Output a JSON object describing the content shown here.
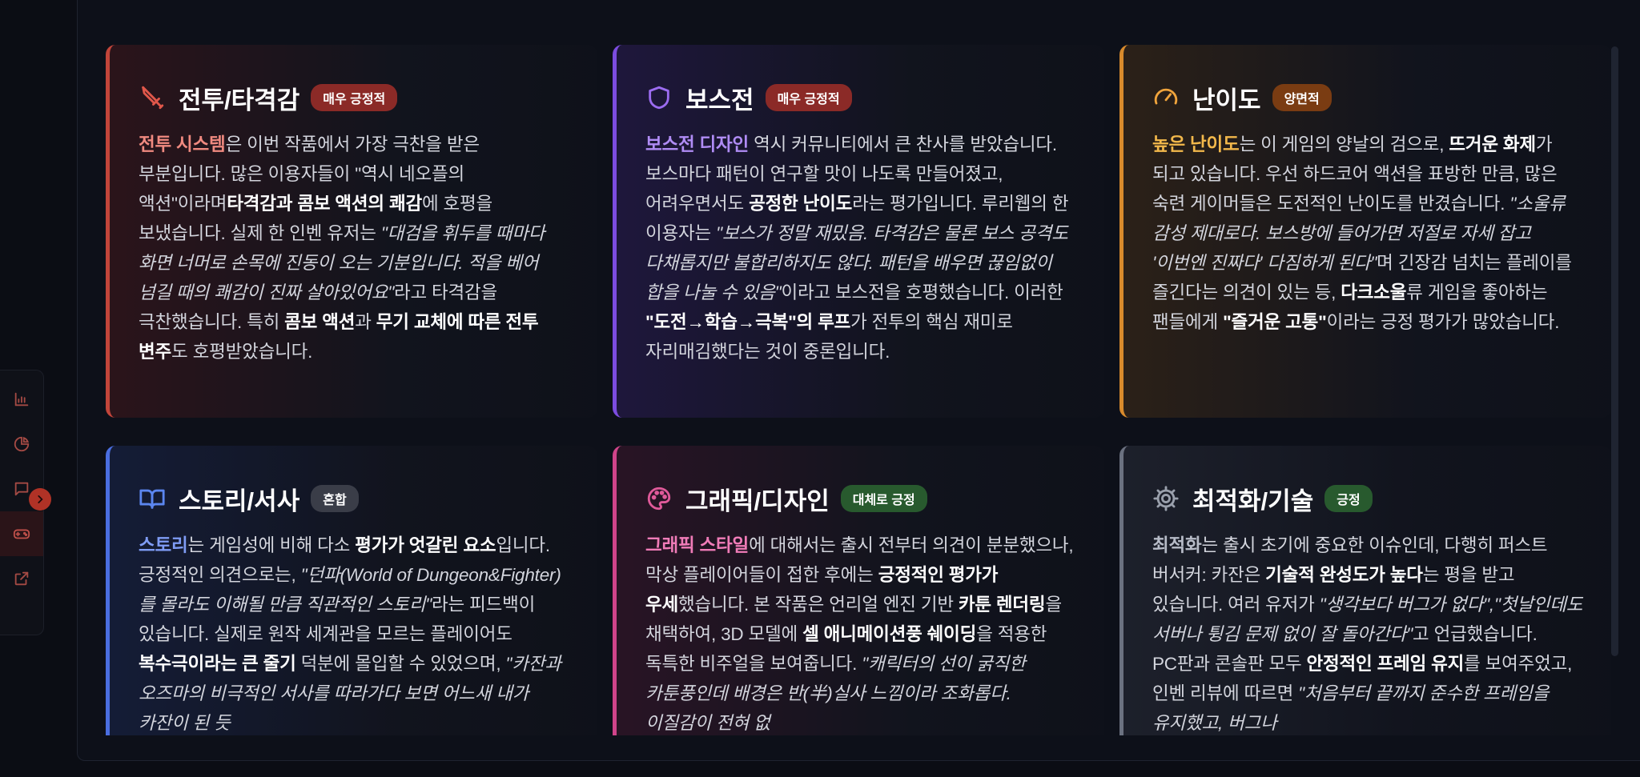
{
  "colors": {
    "battle": "#c2453a",
    "boss": "#7c4ce0",
    "difficulty": "#d88a2c",
    "story": "#4a6ee0",
    "graphics": "#d0448a",
    "tech": "#7d8494",
    "badge_very_positive": "#8b2a27",
    "badge_mixed_side": "#7a3c12",
    "badge_mixed": "#3a3d48",
    "badge_positive": "#285a2e"
  },
  "sidebar": {
    "items": [
      {
        "icon": "bar-chart-icon"
      },
      {
        "icon": "pie-chart-icon"
      },
      {
        "icon": "chat-icon"
      },
      {
        "icon": "gamepad-icon"
      },
      {
        "icon": "external-link-icon"
      }
    ],
    "collapse_icon": "chevron-right-icon"
  },
  "cards": [
    {
      "key": "battle",
      "icon": "sword-icon",
      "title": "전투/타격감",
      "badge": "매우 긍정적",
      "body": [
        {
          "t": "전투 시스템",
          "s": "hl",
          "c": "#f08a80"
        },
        {
          "t": "은 이번 작품에서 가장 극찬을 받은 부분입니다. 많은 이용자들이 \"역시 네오플의 액션\"이라며"
        },
        {
          "t": "타격감과 콤보 액션의 쾌감",
          "s": "b"
        },
        {
          "t": "에 호평을 보냈습니다. 실제 한 인벤 유저는 "
        },
        {
          "t": "\"대검을 휘두를 때마다 화면 너머로 손목에 진동이 오는 기분입니다. 적을 베어 넘길 때의 쾌감이 진짜 살아있어요\"",
          "s": "i"
        },
        {
          "t": "라고 타격감을 극찬했습니다. 특히 "
        },
        {
          "t": "콤보 액션",
          "s": "b"
        },
        {
          "t": "과 "
        },
        {
          "t": "무기 교체에 따른 전투 변주",
          "s": "b"
        },
        {
          "t": "도 호평받았습니다."
        }
      ]
    },
    {
      "key": "boss",
      "icon": "shield-icon",
      "title": "보스전",
      "badge": "매우 긍정적",
      "body": [
        {
          "t": "보스전 디자인",
          "s": "hl",
          "c": "#b08cf5"
        },
        {
          "t": " 역시 커뮤니티에서 큰 찬사를 받았습니다. 보스마다 패턴이 연구할 맛이 나도록 만들어졌고, 어려우면서도 "
        },
        {
          "t": "공정한 난이도",
          "s": "b"
        },
        {
          "t": "라는 평가입니다. 루리웹의 한 이용자는 "
        },
        {
          "t": "\"보스가 정말 재밌음. 타격감은 물론 보스 공격도 다채롭지만 불합리하지도 않다. 패턴을 배우면 끊임없이 합을 나눌 수 있음\"",
          "s": "i"
        },
        {
          "t": "이라고 보스전을 호평했습니다. 이러한 "
        },
        {
          "t": "\"도전→학습→극복\"의 루프",
          "s": "b"
        },
        {
          "t": "가 전투의 핵심 재미로 자리매김했다는 것이 중론입니다."
        }
      ]
    },
    {
      "key": "difficulty",
      "icon": "gauge-icon",
      "title": "난이도",
      "badge": "양면적",
      "body": [
        {
          "t": "높은 난이도",
          "s": "hl",
          "c": "#f2b84b"
        },
        {
          "t": "는 이 게임의 양날의 검으로, "
        },
        {
          "t": "뜨거운 화제",
          "s": "b"
        },
        {
          "t": "가 되고 있습니다. 우선 하드코어 액션을 표방한 만큼, 많은 숙련 게이머들은 도전적인 난이도를 반겼습니다. "
        },
        {
          "t": "\"소울류 감성 제대로다. 보스방에 들어가면 저절로 자세 잡고 '이번엔 진짜다' 다짐하게 된다\"",
          "s": "i"
        },
        {
          "t": "며 긴장감 넘치는 플레이를 즐긴다는 의견이 있는 등, "
        },
        {
          "t": "다크소울",
          "s": "b"
        },
        {
          "t": "류 게임을 좋아하는 팬들에게 "
        },
        {
          "t": "\"즐거운 고통\"",
          "s": "b"
        },
        {
          "t": "이라는 긍정 평가가 많았습니다."
        }
      ]
    },
    {
      "key": "story",
      "icon": "book-icon",
      "title": "스토리/서사",
      "badge": "혼합",
      "body": [
        {
          "t": "스토리",
          "s": "hl",
          "c": "#7f9cf5"
        },
        {
          "t": "는 게임성에 비해 다소 "
        },
        {
          "t": "평가가 엇갈린 요소",
          "s": "b"
        },
        {
          "t": "입니다. 긍정적인 의견으로는, "
        },
        {
          "t": "\"던파(World of Dungeon&Fighter)를 몰라도 이해될 만큼 직관적인 스토리\"",
          "s": "i"
        },
        {
          "t": "라는 피드백이 있습니다. 실제로 원작 세계관을 모르는 플레이어도 "
        },
        {
          "t": "복수극이라는 큰 줄기",
          "s": "b"
        },
        {
          "t": " 덕분에 몰입할 수 있었으며, "
        },
        {
          "t": "\"카잔과 오즈마의 비극적인 서사를 따라가다 보면 어느새 내가 카잔이 된 듯",
          "s": "i"
        }
      ]
    },
    {
      "key": "graphics",
      "icon": "palette-icon",
      "title": "그래픽/디자인",
      "badge": "대체로 긍정",
      "body": [
        {
          "t": "그래픽 스타일",
          "s": "hl",
          "c": "#f07cb8"
        },
        {
          "t": "에 대해서는 출시 전부터 의견이 분분했으나, 막상 플레이어들이 접한 후에는 "
        },
        {
          "t": "긍정적인 평가가 우세",
          "s": "b"
        },
        {
          "t": "했습니다. 본 작품은 언리얼 엔진 기반 "
        },
        {
          "t": "카툰 렌더링",
          "s": "b"
        },
        {
          "t": "을 채택하여, 3D 모델에 "
        },
        {
          "t": "셀 애니메이션풍 쉐이딩",
          "s": "b"
        },
        {
          "t": "을 적용한 독특한 비주얼을 보여줍니다. "
        },
        {
          "t": "\"캐릭터의 선이 굵직한 카툰풍인데 배경은 반(半)실사 느낌이라 조화롭다. 이질감이 전혀 없",
          "s": "i"
        }
      ]
    },
    {
      "key": "tech",
      "icon": "cog-icon",
      "title": "최적화/기술",
      "badge": "긍정",
      "body": [
        {
          "t": "최적화",
          "s": "hl",
          "c": "#b7bcc8"
        },
        {
          "t": "는 출시 초기에 중요한 이슈인데, 다행히 퍼스트 버서커: 카잔은 "
        },
        {
          "t": "기술적 완성도가 높다",
          "s": "b"
        },
        {
          "t": "는 평을 받고 있습니다. 여러 유저가 "
        },
        {
          "t": "\"생각보다 버그가 없다\",\"첫날인데도 서버나 튕김 문제 없이 잘 돌아간다\"",
          "s": "i"
        },
        {
          "t": "고 언급했습니다. PC판과 콘솔판 모두 "
        },
        {
          "t": "안정적인 프레임 유지",
          "s": "b"
        },
        {
          "t": "를 보여주었고, 인벤 리뷰에 따르면 "
        },
        {
          "t": "\"처음부터 끝까지 준수한 프레임을 유지했고, 버그나",
          "s": "i"
        }
      ]
    }
  ]
}
